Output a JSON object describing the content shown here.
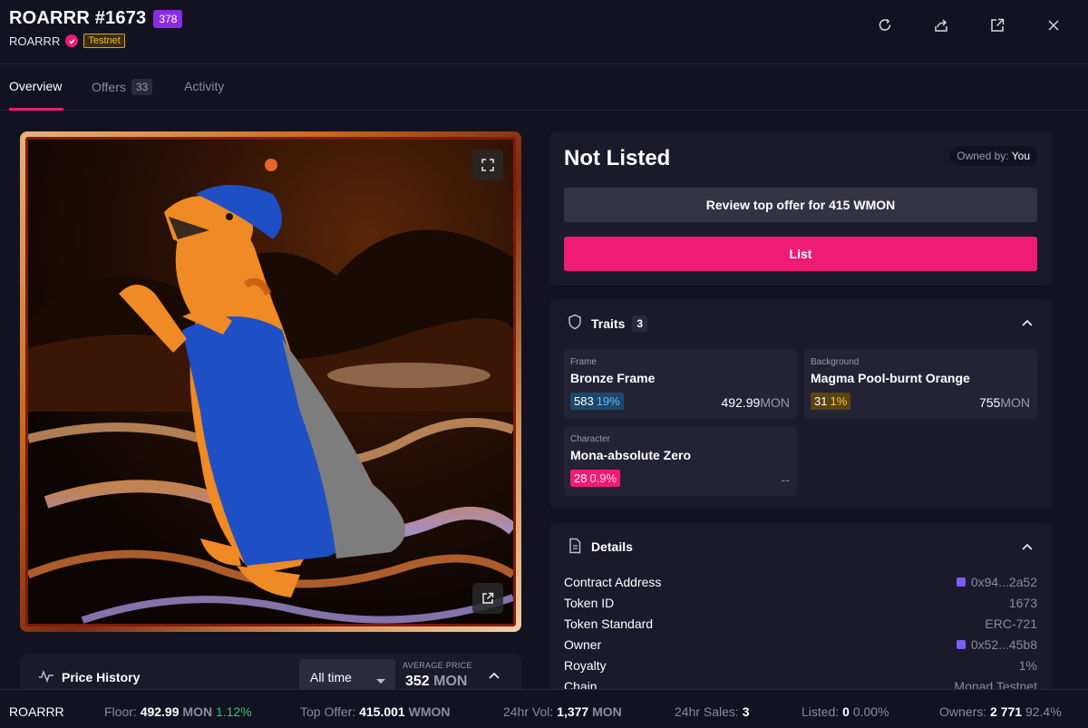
{
  "header": {
    "title": "ROARRR #1673",
    "rank": "378",
    "collection": "ROARRR",
    "network_badge": "Testnet",
    "icons": [
      "refresh-icon",
      "share-icon",
      "external-link-icon",
      "close-icon"
    ]
  },
  "tabs": [
    {
      "label": "Overview",
      "active": true
    },
    {
      "label": "Offers",
      "count": "33"
    },
    {
      "label": "Activity"
    }
  ],
  "listing": {
    "status": "Not Listed",
    "owned_label": "Owned by:",
    "owner": "You",
    "offer_button": "Review top offer for 415 WMON",
    "list_button": "List"
  },
  "traits": {
    "title": "Traits",
    "count": "3",
    "items": [
      {
        "category": "Frame",
        "value": "Bronze Frame",
        "count": "583",
        "pct": "19%",
        "price": "492.99",
        "unit": "MON"
      },
      {
        "category": "Background",
        "value": "Magma Pool-burnt Orange",
        "count": "31",
        "pct": "1%",
        "price": "755",
        "unit": "MON"
      },
      {
        "category": "Character",
        "value": "Mona-absolute Zero",
        "count": "28",
        "pct": "0.9%",
        "price": "--",
        "unit": ""
      }
    ]
  },
  "details": {
    "title": "Details",
    "rows": [
      {
        "key": "Contract Address",
        "value": "0x94...2a52"
      },
      {
        "key": "Token ID",
        "value": "1673"
      },
      {
        "key": "Token Standard",
        "value": "ERC-721"
      },
      {
        "key": "Owner",
        "value": "0x52...45b8"
      },
      {
        "key": "Royalty",
        "value": "1%"
      },
      {
        "key": "Chain",
        "value": "Monad Testnet"
      }
    ]
  },
  "price_history": {
    "title": "Price History",
    "range": "All time",
    "avg_label": "AVERAGE PRICE",
    "avg_value": "352",
    "avg_unit": "MON"
  },
  "stats": {
    "collection": "ROARRR",
    "floor_label": "Floor:",
    "floor_value": "492.99",
    "floor_unit": "MON",
    "floor_change": "1.12%",
    "top_offer_label": "Top Offer:",
    "top_offer_value": "415.001",
    "top_offer_unit": "WMON",
    "vol_label": "24hr Vol:",
    "vol_value": "1,377",
    "vol_unit": "MON",
    "sales_label": "24hr Sales:",
    "sales_value": "3",
    "listed_label": "Listed:",
    "listed_value": "0",
    "listed_pct": "0.00%",
    "owners_label": "Owners:",
    "owners_value": "2 771",
    "owners_pct": "92.4%"
  },
  "colors": {
    "accent": "#ee1c74",
    "rank_badge": "#8b2be2",
    "background": "#131221",
    "card": "#1b1a2b"
  }
}
